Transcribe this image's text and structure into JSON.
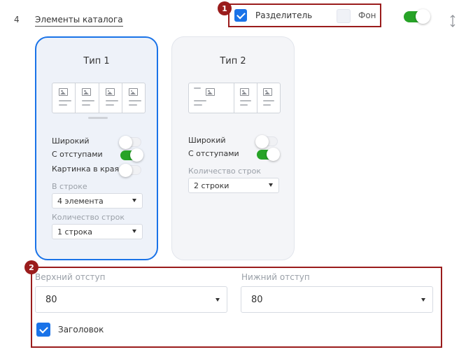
{
  "row": {
    "number": "4",
    "title": "Элементы каталога"
  },
  "header": {
    "badge": "1",
    "divider": {
      "label": "Разделитель",
      "checked": true
    },
    "background": {
      "label": "Фон",
      "checked": false
    },
    "main_toggle": true,
    "resize_icon": "vertical-resize-icon"
  },
  "cards": [
    {
      "title": "Тип 1",
      "selected": true,
      "options": [
        {
          "label": "Широкий",
          "on": false
        },
        {
          "label": "С отступами",
          "on": true
        },
        {
          "label": "Картинка в края",
          "on": false
        }
      ],
      "per_row_label": "В строке",
      "per_row_value": "4 элемента",
      "rows_label": "Количество строк",
      "rows_value": "1 строка"
    },
    {
      "title": "Тип 2",
      "selected": false,
      "options": [
        {
          "label": "Широкий",
          "on": false
        },
        {
          "label": "С отступами",
          "on": true
        }
      ],
      "rows_label": "Количество строк",
      "rows_value": "2 строки"
    }
  ],
  "spacing": {
    "badge": "2",
    "top_label": "Верхний отступ",
    "top_value": "80",
    "bottom_label": "Нижний отступ",
    "bottom_value": "80",
    "heading": {
      "label": "Заголовок",
      "checked": true
    }
  },
  "colors": {
    "accent": "#1a73e8",
    "toggle_on": "#27a327",
    "highlight": "#9a1c1c"
  }
}
